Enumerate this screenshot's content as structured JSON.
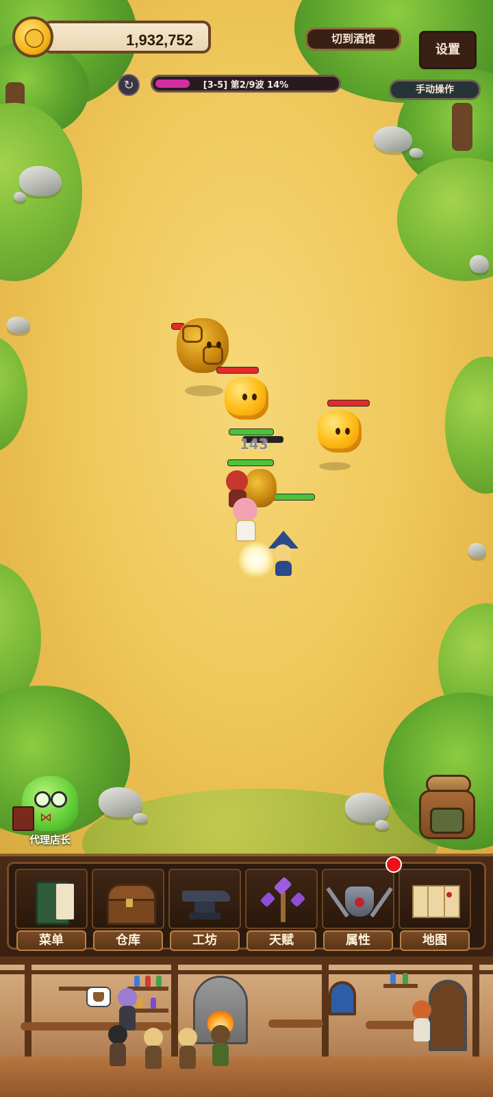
{
  "hud": {
    "coin_amount": "1,932,752",
    "switch_tavern_label": "切到酒馆",
    "settings_label": "设置",
    "manual_label": "手动操作",
    "wave_text": "[3-5]  第2/9波  14%",
    "wave_progress_percent": 14
  },
  "battle": {
    "damage_number": "143"
  },
  "manager": {
    "label": "代理店长"
  },
  "menu": {
    "items": [
      {
        "label": "菜单",
        "icon": "book-icon"
      },
      {
        "label": "仓库",
        "icon": "chest-icon"
      },
      {
        "label": "工坊",
        "icon": "anvil-icon"
      },
      {
        "label": "天赋",
        "icon": "crystal-tree-icon"
      },
      {
        "label": "属性",
        "icon": "armor-icon",
        "has_notification": true
      },
      {
        "label": "地图",
        "icon": "map-icon"
      }
    ]
  },
  "colors": {
    "ground": "#f0c95c",
    "panel": "#3a2010",
    "wave_fill": "#d12fa0",
    "notification": "#e8141a"
  }
}
